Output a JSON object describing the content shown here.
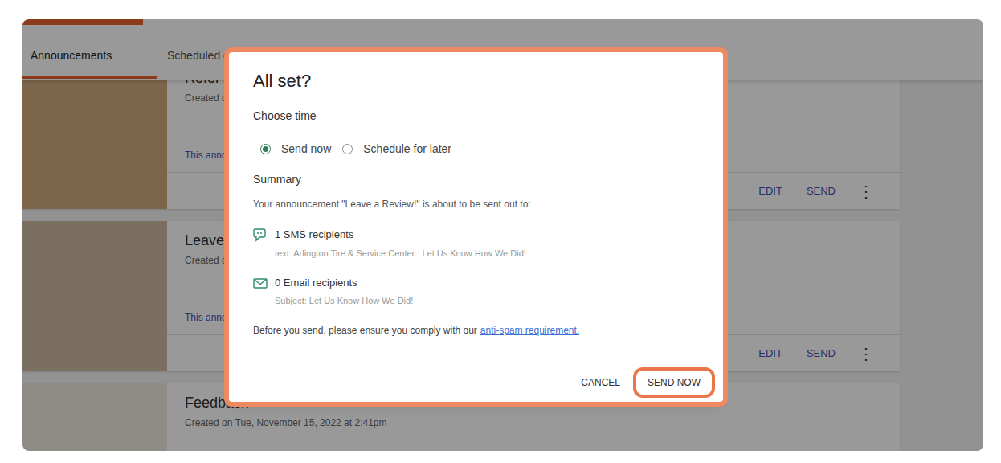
{
  "tabs": [
    {
      "label": "Announcements",
      "selected": true
    },
    {
      "label": "Scheduled d",
      "selected": false
    }
  ],
  "announcements": [
    {
      "title": "Refer a",
      "created": "Created o",
      "description": "This anno",
      "actions": [
        "EDIT",
        "SEND",
        "⋮"
      ]
    },
    {
      "title": "Leave a",
      "created": "Created o",
      "description": "This anno",
      "actions": [
        "EDIT",
        "SEND",
        "⋮"
      ]
    },
    {
      "title": "Feedback",
      "created": "Created on Tue, November 15, 2022 at 2:41pm",
      "description": "",
      "actions": []
    }
  ],
  "dialog": {
    "title": "All set?",
    "choose_time_label": "Choose time",
    "time_options": [
      {
        "label": "Send now",
        "selected": true
      },
      {
        "label": "Schedule for later",
        "selected": false
      }
    ],
    "summary_label": "Summary",
    "summary_text": "Your announcement \"Leave a Review!\" is about to be sent out to:",
    "recipients": [
      {
        "kind": "sms",
        "label": "1 SMS recipients",
        "detail": "text: Arlington Tire & Service Center : Let Us Know How We Did!"
      },
      {
        "kind": "email",
        "label": "0 Email recipients",
        "detail": "Subject: Let Us Know How We Did!"
      }
    ],
    "notice": "Before you send, please ensure you comply with our",
    "notice_link": "anti-spam requirement.",
    "buttons": [
      {
        "label": "CANCEL",
        "highlighted": false
      },
      {
        "label": "SEND NOW",
        "highlighted": true
      }
    ]
  }
}
